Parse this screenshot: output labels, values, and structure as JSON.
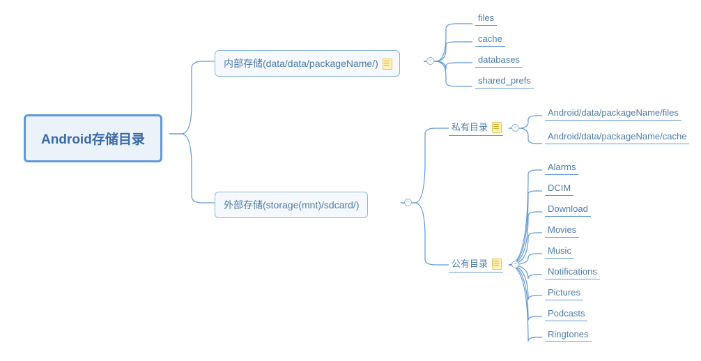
{
  "root": {
    "label": "Android存储目录"
  },
  "branch_internal": {
    "label": "内部存储(data/data/packageName/)"
  },
  "branch_external": {
    "label": "外部存储(storage(mnt)/sdcard/)"
  },
  "sub_private": {
    "label": "私有目录"
  },
  "sub_public": {
    "label": "公有目录"
  },
  "internal_children": {
    "files": "files",
    "cache": "cache",
    "databases": "databases",
    "shared_prefs": "shared_prefs"
  },
  "private_children": {
    "files": "Android/data/packageName/files",
    "cache": "Android/data/packageName/cache"
  },
  "public_children": {
    "alarms": "Alarms",
    "dcim": "DCIM",
    "download": "Download",
    "movies": "Movies",
    "music": "Music",
    "notifications": "Notifications",
    "pictures": "Pictures",
    "podcasts": "Podcasts",
    "ringtones": "Ringtones"
  },
  "colors": {
    "stroke": "#5f98d6"
  }
}
